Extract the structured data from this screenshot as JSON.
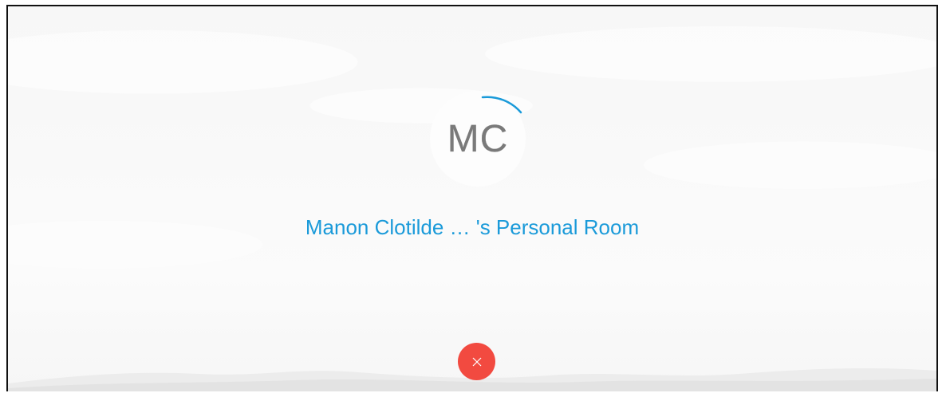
{
  "avatar": {
    "initials": "MC"
  },
  "room": {
    "title": "Manon Clotilde … 's Personal Room"
  },
  "controls": {
    "end_icon": "close-icon",
    "end_color": "#f24a40"
  },
  "colors": {
    "accent": "#1a9ad9",
    "background": "#f8f8f8"
  }
}
